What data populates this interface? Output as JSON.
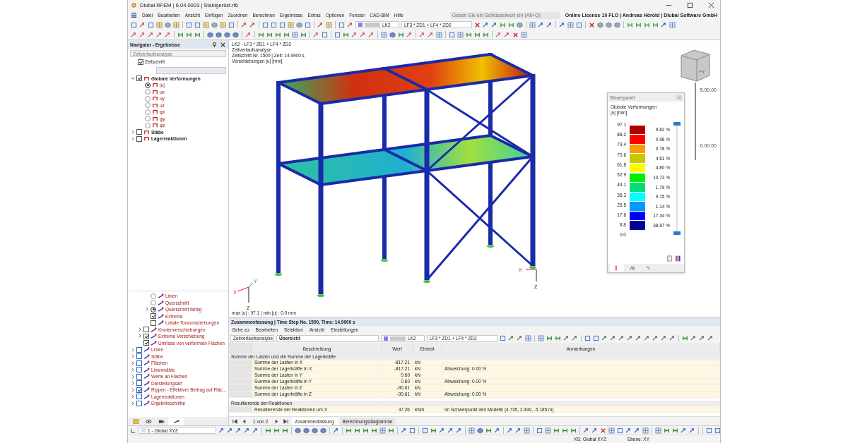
{
  "window": {
    "title": "Dlubal RFEM | 6.04.0003 | Stahlgerüst.rf6"
  },
  "menu": [
    "Datei",
    "Bearbeiten",
    "Ansicht",
    "Einfügen",
    "Zuordnen",
    "Berechnen",
    "Ergebnisse",
    "Extras",
    "Optionen",
    "Fenster",
    "CAD-BIM",
    "Hilfe"
  ],
  "search": {
    "placeholder": "Geben Sie ein Schlüsselwort ein (Alt+Q)"
  },
  "license": "Online License 10 FLO | Andreas Hörold | Dlubal Software GmbH",
  "toolbar": {
    "load_case": "LK2",
    "combination": "LF3 * ZD1 + LF4 * ZD2"
  },
  "navigator": {
    "title": "Navigator - Ergebnisse",
    "analysis": "Zeitverlaufsanalyse",
    "time_step": {
      "label": "Zeitschritt",
      "checked": true
    },
    "tree": [
      {
        "label": "Globale Verformungen",
        "checked": true,
        "expanded": true,
        "children": [
          {
            "label": "|u|",
            "selected": true
          },
          {
            "label": "ux",
            "selected": false
          },
          {
            "label": "uy",
            "selected": false
          },
          {
            "label": "uz",
            "selected": false
          },
          {
            "label": "φx",
            "selected": false
          },
          {
            "label": "φy",
            "selected": false
          },
          {
            "label": "φz",
            "selected": false
          }
        ]
      },
      {
        "label": "Stäbe",
        "checked": false,
        "expanded": false
      },
      {
        "label": "Lagerreaktionen",
        "checked": false,
        "expanded": false
      }
    ],
    "display_options": {
      "deep_items": [
        {
          "kind": "radio",
          "label": "Linien",
          "selected": false
        },
        {
          "kind": "radio",
          "label": "Querschnitt",
          "selected": false
        },
        {
          "kind": "radio",
          "label": "Querschnitt farbig",
          "selected": true,
          "expanded": false
        },
        {
          "kind": "checkbox",
          "label": "Extrema",
          "checked": true
        },
        {
          "kind": "checkbox",
          "label": "Lokale Torsionsdrehungen",
          "checked": false
        }
      ],
      "mid_items": [
        {
          "kind": "checkbox",
          "label": "Knotenverschiebungen",
          "checked": false,
          "expanded": false
        },
        {
          "kind": "checkbox",
          "label": "Extreme Verschiebung",
          "checked": true,
          "expanded": false
        },
        {
          "kind": "checkbox",
          "label": "Umrisse von verformten Flächen",
          "checked": true
        }
      ],
      "items": [
        {
          "label": "Linien",
          "checked": false
        },
        {
          "label": "Stäbe",
          "checked": false
        },
        {
          "label": "Flächen",
          "checked": false
        },
        {
          "label": "Liniennähte",
          "checked": false
        },
        {
          "label": "Werte an Flächen",
          "checked": false
        },
        {
          "label": "Darstellungsart",
          "checked": false
        },
        {
          "label": "Rippen - Effektiver Beitrag auf Fläc...",
          "checked": true
        },
        {
          "label": "Lagerreaktionen",
          "checked": false
        },
        {
          "label": "Ergebnisschnitte",
          "checked": false
        }
      ]
    }
  },
  "viewport": {
    "info_lines": [
      "LK2 - LF3 * ZD1 + LF4 * ZD2",
      "Zeitverlaufsanalyse",
      "Zeitschritt Nr. 1500 | Zeit: 14.9900 s",
      "Verschiebungen |u| [mm]"
    ],
    "summary": "max |u| : 97.1 | min |u| : 0.0 mm",
    "cube_label": "+Y",
    "scale_labels": [
      "5.00.00",
      "0.00.00"
    ],
    "axes": [
      "X",
      "Y",
      "Z"
    ],
    "support_axes": [
      "X",
      "Z"
    ]
  },
  "control_panel": {
    "title": "Steuerpanel",
    "slider": {
      "level": 1
    },
    "heading": "Globale Verformungen",
    "unit": "|u| [mm]",
    "values": [
      "97.1",
      "88.2",
      "79.4",
      "70.6",
      "61.8",
      "52.9",
      "44.1",
      "35.3",
      "26.5",
      "17.6",
      "8.8",
      "0.0"
    ],
    "bands": [
      {
        "color": "#b00000",
        "percent": "9.82 %"
      },
      {
        "color": "#ff0000",
        "percent": "0.96 %"
      },
      {
        "color": "#ff9900",
        "percent": "0.78 %"
      },
      {
        "color": "#c8c800",
        "percent": "4.61 %"
      },
      {
        "color": "#ffff00",
        "percent": "4.80 %"
      },
      {
        "color": "#00ee00",
        "percent": "10.73 %"
      },
      {
        "color": "#00dd77",
        "percent": "1.79 %"
      },
      {
        "color": "#00ffff",
        "percent": "9.15 %"
      },
      {
        "color": "#0099ff",
        "percent": "1.14 %"
      },
      {
        "color": "#0000ff",
        "percent": "17.34 %"
      },
      {
        "color": "#000099",
        "percent": "38.87 %"
      }
    ]
  },
  "results": {
    "title": "Zusammenfassung | Time Step No. 1500, Time: 14.9900 s",
    "menu": [
      "Gehe zu",
      "Bearbeiten",
      "Selektion",
      "Ansicht",
      "Einstellungen"
    ],
    "analysis": "Zeitverlaufsanalyse",
    "view": "Übersicht",
    "load_case": "LK2",
    "combination": "LF3 * ZD1 + LF4 * ZD2",
    "columns": [
      "Beschreibung",
      "Wert",
      "Einheit",
      "Anmerkungen"
    ],
    "sections": [
      {
        "title": "Summe der Lasten und die Summe der Lagerkräfte",
        "rows": [
          {
            "description": "Summe der Lasten in X",
            "value": "-817.21",
            "unit": "kN"
          },
          {
            "description": "Summe der Lagerkräfte in X",
            "value": "-817.21",
            "unit": "kN",
            "note": "Abweichung: 0.00 %"
          },
          {
            "description": "Summe der Lasten in Y",
            "value": "0.60",
            "unit": "kN"
          },
          {
            "description": "Summe der Lagerkräfte in Y",
            "value": "0.60",
            "unit": "kN",
            "note": "Abweichung: 0.00 %"
          },
          {
            "description": "Summe der Lasten in Z",
            "value": "-90.61",
            "unit": "kN"
          },
          {
            "description": "Summe der Lagerkräfte in Z",
            "value": "-90.61",
            "unit": "kN",
            "note": "Abweichung: 0.00 %"
          }
        ]
      },
      {
        "title": "Resultierende der Reaktionen",
        "rows": [
          {
            "description": "Resultierende der Reaktionen um X",
            "value": "37.26",
            "unit": "kNm",
            "note": "Im Schwerpunkt des Modells (4.735, 2.490, -5.185 m)"
          }
        ]
      }
    ],
    "pager": "1 von 2",
    "tabs": [
      {
        "label": "Zusammenfassung",
        "selected": true
      },
      {
        "label": "Berechnungsdiagramme",
        "selected": false
      }
    ]
  },
  "status_bar": {
    "coordinate_system": "1 - Global XYZ",
    "ks": "KS: Global XYZ",
    "plane": "Ebene: XY"
  }
}
